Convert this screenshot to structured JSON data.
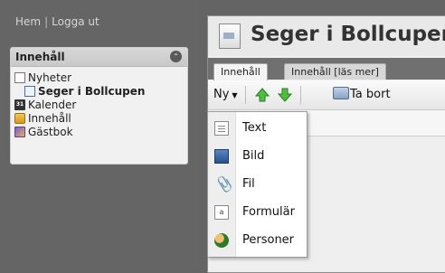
{
  "topnav": {
    "home": "Hem",
    "separator": "|",
    "logout": "Logga ut"
  },
  "sidebar": {
    "title": "Innehåll",
    "items": [
      {
        "label": "Nyheter",
        "icon": "document-icon"
      },
      {
        "label": "Seger i Bollcupen",
        "icon": "page-icon"
      },
      {
        "label": "Kalender",
        "icon": "calendar-icon"
      },
      {
        "label": "Innehåll",
        "icon": "box-icon"
      },
      {
        "label": "Gästbok",
        "icon": "guestbook-icon"
      }
    ]
  },
  "page": {
    "title": "Seger i Bollcupen"
  },
  "tabs": [
    {
      "label": "Innehåll"
    },
    {
      "label": "Innehåll [läs mer]"
    }
  ],
  "toolbar": {
    "new_label": "Ny",
    "delete_label": "Ta bort"
  },
  "dropdown": {
    "items": [
      {
        "label": "Text",
        "icon": "text-icon"
      },
      {
        "label": "Bild",
        "icon": "image-icon"
      },
      {
        "label": "Fil",
        "icon": "paperclip-icon"
      },
      {
        "label": "Formulär",
        "icon": "form-icon"
      },
      {
        "label": "Personer",
        "icon": "people-icon"
      }
    ]
  },
  "colors": {
    "background": "#646464",
    "arrow_green": "#3aa53a"
  }
}
